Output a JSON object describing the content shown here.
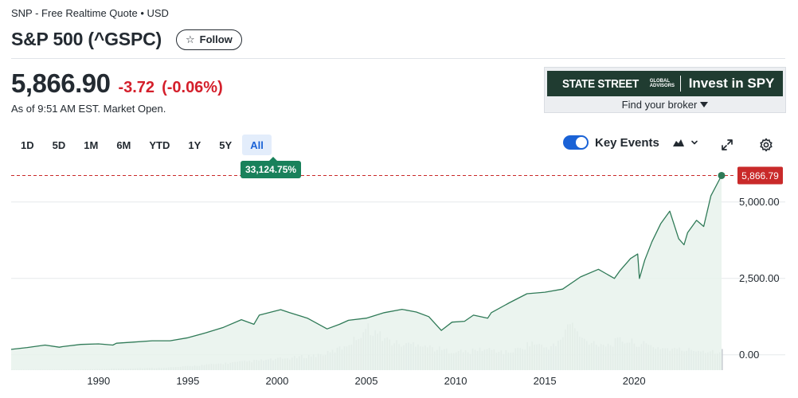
{
  "header": {
    "source": "SNP - Free Realtime Quote • USD",
    "title": "S&P 500 (^GSPC)",
    "follow_label": "Follow"
  },
  "quote": {
    "price": "5,866.90",
    "change": "-3.72",
    "change_pct": "(-0.06%)",
    "as_of": "As of 9:51 AM EST. Market Open."
  },
  "ad": {
    "brand": "STATE STREET",
    "brand_sub": "GLOBAL ADVISORS",
    "cta": "Invest in SPY",
    "broker": "Find your broker"
  },
  "ranges": [
    "1D",
    "5D",
    "1M",
    "6M",
    "YTD",
    "1Y",
    "5Y",
    "All"
  ],
  "active_range": "All",
  "tooltip": "33,124.75%",
  "controls": {
    "key_events_label": "Key Events",
    "key_events_on": true,
    "icons": [
      "chart-type-icon",
      "chevron-down-icon",
      "expand-icon",
      "gear-icon"
    ]
  },
  "chart_data": {
    "type": "area",
    "x_ticks": [
      "1990",
      "1995",
      "2000",
      "2005",
      "2010",
      "2015",
      "2020"
    ],
    "y_ticks": [
      "0.00",
      "2,500.00",
      "5,000.00"
    ],
    "last_price_label": "5,866.79",
    "xlim": [
      1985.1,
      2024.9
    ],
    "ylim": [
      -500,
      6400
    ],
    "colors": {
      "line": "#2f7a57",
      "fill": "#e8f2ec",
      "price_tag": "#c92a2a",
      "volume": "#c9cdd2"
    },
    "series": [
      {
        "x": [
          1985.1,
          1986,
          1987,
          1987.8,
          1988,
          1989,
          1990,
          1990.8,
          1991,
          1992,
          1993,
          1994,
          1995,
          1996,
          1997,
          1998,
          1998.7,
          1999,
          2000.2,
          2000.7,
          2001.7,
          2002.8,
          2003.5,
          2004,
          2005,
          2006,
          2007,
          2007.8,
          2008.5,
          2009.2,
          2009.8,
          2010.5,
          2011,
          2011.8,
          2012,
          2013,
          2014,
          2015,
          2016,
          2017,
          2018,
          2018.9,
          2019.2,
          2019.8,
          2020.2,
          2020.3,
          2020.6,
          2021,
          2021.5,
          2022,
          2022.5,
          2022.8,
          2023,
          2023.5,
          2023.9,
          2024.3,
          2024.9
        ],
        "y": [
          180,
          240,
          320,
          250,
          270,
          340,
          360,
          320,
          380,
          420,
          460,
          460,
          560,
          720,
          900,
          1150,
          1000,
          1300,
          1480,
          1380,
          1200,
          850,
          1000,
          1130,
          1200,
          1380,
          1490,
          1400,
          1250,
          800,
          1070,
          1100,
          1300,
          1200,
          1380,
          1700,
          2000,
          2050,
          2150,
          2550,
          2800,
          2500,
          2750,
          3150,
          3300,
          2500,
          3100,
          3700,
          4300,
          4700,
          3800,
          3600,
          4000,
          4400,
          4200,
          5200,
          5867
        ]
      }
    ],
    "volume_relative": [
      0.0,
      0.0,
      0.01,
      0.01,
      0.01,
      0.01,
      0.02,
      0.02,
      0.03,
      0.03,
      0.04,
      0.04,
      0.05,
      0.06,
      0.08,
      0.1,
      0.12,
      0.14,
      0.16,
      0.18,
      0.2,
      0.22,
      0.24,
      0.27,
      0.3,
      0.34,
      0.45,
      0.6,
      0.85,
      0.7,
      0.55,
      0.5,
      0.55,
      0.45,
      0.4,
      0.38,
      0.36,
      0.42,
      0.4,
      0.35,
      0.42,
      0.55,
      0.45,
      0.5,
      0.95,
      0.6,
      0.55,
      0.5,
      0.6,
      0.55,
      0.5,
      0.45,
      0.42,
      0.4,
      0.4,
      0.38,
      0.38
    ]
  }
}
